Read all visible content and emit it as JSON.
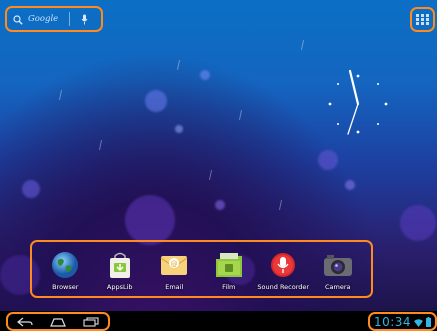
{
  "search": {
    "label": "Google"
  },
  "apps": [
    {
      "label": "Browser",
      "icon": "globe-icon"
    },
    {
      "label": "AppsLib",
      "icon": "shopping-bag-icon"
    },
    {
      "label": "Email",
      "icon": "envelope-icon"
    },
    {
      "label": "Film",
      "icon": "folder-film-icon"
    },
    {
      "label": "Sound Recorder",
      "icon": "microphone-icon"
    },
    {
      "label": "Camera",
      "icon": "camera-icon"
    }
  ],
  "status": {
    "time": "10:34"
  },
  "colors": {
    "highlight": "#ff8a1f",
    "clock": "#33b5e5"
  }
}
